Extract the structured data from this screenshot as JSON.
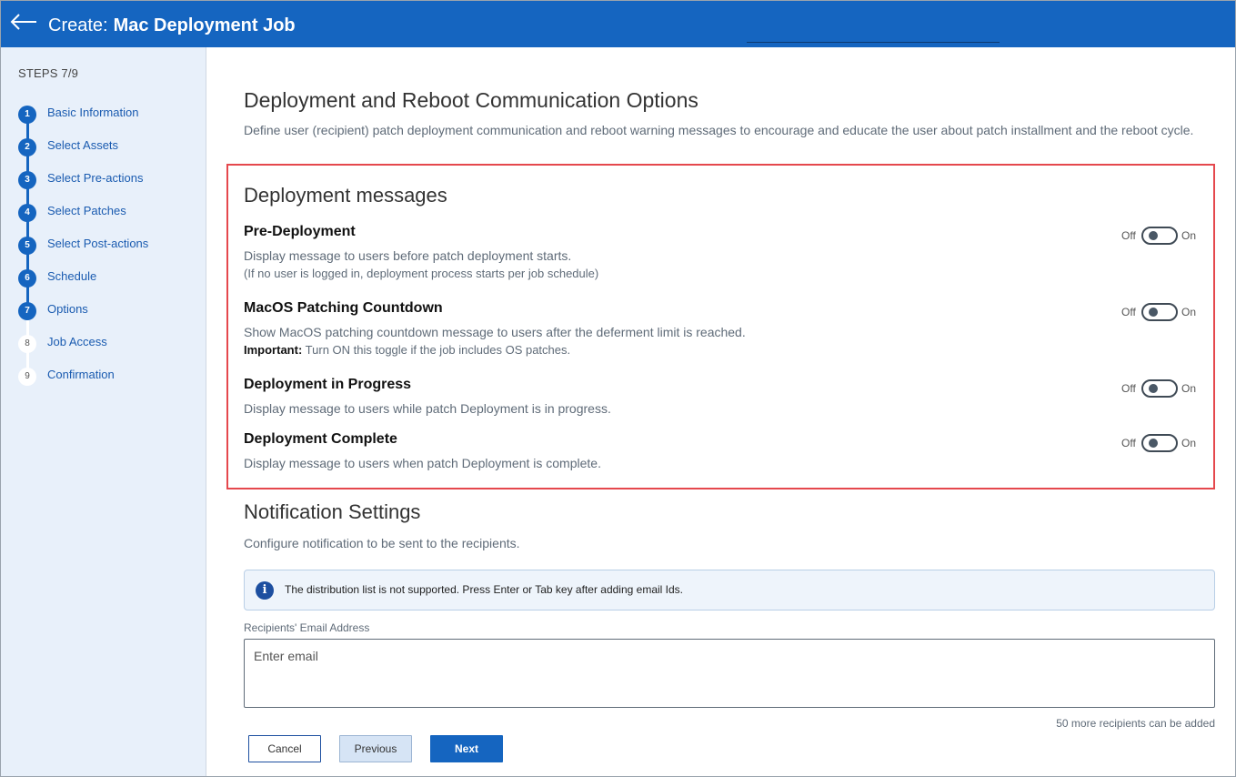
{
  "header": {
    "title_prefix": "Create:",
    "title_name": "Mac Deployment Job"
  },
  "sidebar": {
    "steps_label": "STEPS 7/9",
    "steps": [
      {
        "num": "1",
        "label": "Basic Information",
        "done": true
      },
      {
        "num": "2",
        "label": "Select Assets",
        "done": true
      },
      {
        "num": "3",
        "label": "Select Pre-actions",
        "done": true
      },
      {
        "num": "4",
        "label": "Select Patches",
        "done": true
      },
      {
        "num": "5",
        "label": "Select Post-actions",
        "done": true
      },
      {
        "num": "6",
        "label": "Schedule",
        "done": true
      },
      {
        "num": "7",
        "label": "Options",
        "done": true
      },
      {
        "num": "8",
        "label": "Job Access",
        "done": false
      },
      {
        "num": "9",
        "label": "Confirmation",
        "done": false
      }
    ]
  },
  "main": {
    "title": "Deployment and Reboot Communication Options",
    "description": "Define user (recipient) patch deployment communication and reboot warning messages to encourage and educate the user about patch installment and the reboot cycle.",
    "deployment_messages": {
      "heading": "Deployment messages",
      "items": [
        {
          "title": "Pre-Deployment",
          "desc": "Display message to users before patch deployment starts.",
          "note": "(If no user is logged in, deployment process starts per job schedule)",
          "off_label": "Off",
          "on_label": "On",
          "enabled": false
        },
        {
          "title": "MacOS Patching Countdown",
          "desc": "Show MacOS patching countdown message to users after the deferment limit is reached.",
          "note_bold": "Important:",
          "note": "Turn ON this toggle if the job includes OS patches.",
          "off_label": "Off",
          "on_label": "On",
          "enabled": false
        },
        {
          "title": "Deployment in Progress",
          "desc": "Display message to users while patch Deployment is in progress.",
          "off_label": "Off",
          "on_label": "On",
          "enabled": false
        },
        {
          "title": "Deployment Complete",
          "desc": "Display message to users when patch Deployment is complete.",
          "off_label": "Off",
          "on_label": "On",
          "enabled": false
        }
      ]
    },
    "notification": {
      "heading": "Notification Settings",
      "desc": "Configure notification to be sent to the recipients.",
      "info_icon": "info-icon",
      "info_text": "The distribution list is not supported. Press Enter or Tab key after adding email Ids.",
      "email_label": "Recipients' Email Address",
      "email_placeholder": "Enter email",
      "email_value": "",
      "recipients_remaining": "50 more recipients can be added"
    },
    "buttons": {
      "cancel": "Cancel",
      "previous": "Previous",
      "next": "Next"
    }
  },
  "colors": {
    "header": "#1565c0",
    "sidebar": "#e8f0fa",
    "highlight_border": "#e5484d"
  }
}
